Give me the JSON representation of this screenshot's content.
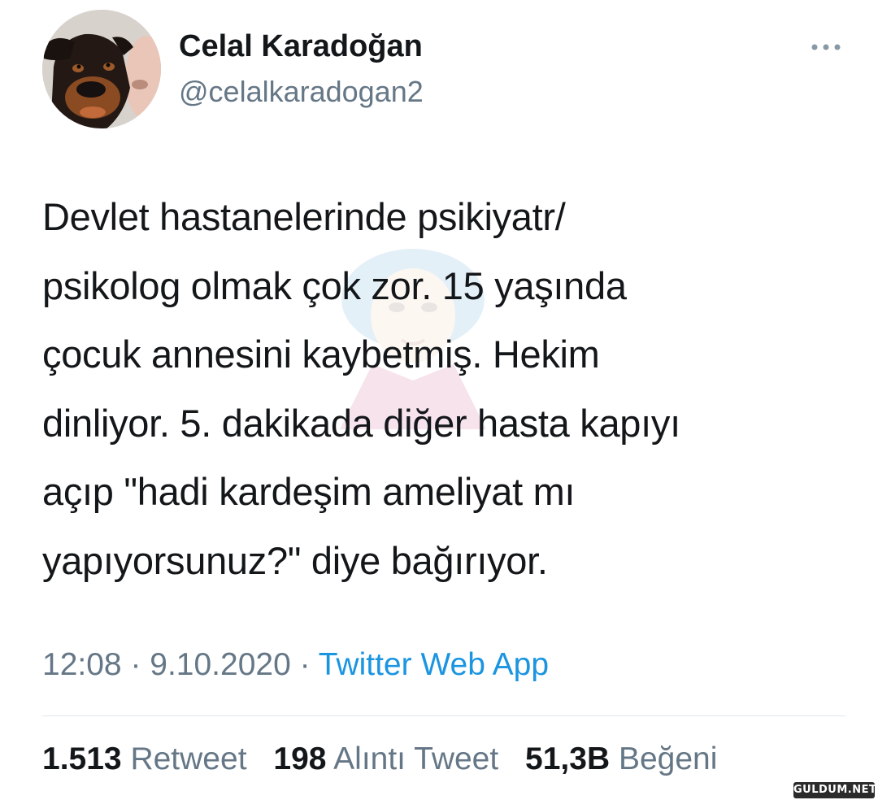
{
  "author": {
    "display_name": "Celal Karadoğan",
    "handle": "@celalkaradogan2",
    "avatar_icon": "dog-avatar"
  },
  "more_icon": "more-horizontal-icon",
  "tweet": {
    "text": "Devlet hastanelerinde psikiyatr/\npsikolog olmak çok zor. 15 yaşında\nçocuk annesini kaybetmiş. Hekim\ndinliyor. 5. dakikada diğer hasta kapıyı\naçıp \"hadi kardeşim ameliyat mı\nyapıyorsunuz?\" diye bağırıyor."
  },
  "meta": {
    "time": "12:08",
    "separator": " · ",
    "date": "9.10.2020",
    "source": "Twitter Web App"
  },
  "stats": {
    "retweets_count": "1.513",
    "retweets_label": "Retweet",
    "quotes_count": "198",
    "quotes_label": "Alıntı Tweet",
    "likes_count": "51,3B",
    "likes_label": "Beğeni"
  },
  "watermark": "GULDUM.NET",
  "colors": {
    "text_primary": "#14171a",
    "text_secondary": "#657786",
    "link": "#1b95e0",
    "divider": "#e1e8ed"
  }
}
